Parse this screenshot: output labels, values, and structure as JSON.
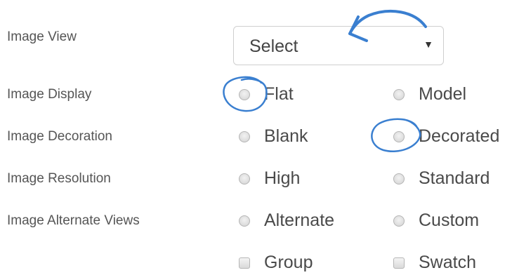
{
  "form": {
    "rows": [
      {
        "label": "Image View"
      },
      {
        "label": "Image Display"
      },
      {
        "label": "Image Decoration"
      },
      {
        "label": "Image Resolution"
      },
      {
        "label": "Image Alternate Views"
      }
    ],
    "image_view_select": {
      "value": "Select",
      "caret": "▼"
    },
    "display_options": {
      "flat": "Flat",
      "model": "Model"
    },
    "decoration_options": {
      "blank": "Blank",
      "decorated": "Decorated"
    },
    "resolution_options": {
      "high": "High",
      "standard": "Standard"
    },
    "alternate_options": {
      "alternate": "Alternate",
      "custom": "Custom"
    },
    "extra_checkboxes": {
      "group": "Group",
      "swatch": "Swatch"
    }
  },
  "annotations": {
    "color": "#3a7fd0",
    "arrow_target": "image-view-select",
    "circled_options": [
      "Flat",
      "Decorated"
    ]
  }
}
